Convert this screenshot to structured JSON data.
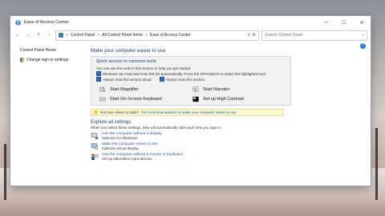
{
  "window": {
    "title": "Ease of Access Center",
    "controls": {
      "minimize": "—",
      "maximize": "☐",
      "close": "✕"
    }
  },
  "address": {
    "back": "←",
    "forward": "→",
    "up_chevron": "˅",
    "up": "↑",
    "crumbs": [
      "Control Panel",
      "All Control Panel Items",
      "Ease of Access Center"
    ],
    "separator": ">",
    "dropdown": "˅",
    "refresh": "⟳"
  },
  "search": {
    "placeholder": "Search Control Panel",
    "icon": "⌕"
  },
  "left": {
    "home": "Control Panel Home",
    "signin": "Change sign-in settings"
  },
  "main": {
    "heading": "Make your computer easier to use",
    "quick": {
      "title": "Quick access to common tools",
      "line1": "You can use the tools in this section to help you get started.",
      "line2": "Windows can read and scan this list automatically.  Press the SPACEBAR to select the highlighted tool.",
      "cb1": "Always read this section aloud",
      "cb2": "Always scan this section",
      "tools": {
        "magnifier": "Start Magnifier",
        "narrator": "Start Narrator",
        "keyboard": "Start On-Screen Keyboard",
        "contrast": "Set up High Contrast"
      }
    },
    "tip": {
      "text": "Not sure where to start?",
      "link": "Get recommendations to make your computer easier to use"
    },
    "explore": {
      "title": "Explore all settings",
      "subtitle": "When you select these settings, they will automatically start each time you sign in.",
      "options": [
        {
          "link": "Use the computer without a display",
          "desc": "Optimize for blindness"
        },
        {
          "link": "Make the computer easier to see",
          "desc": "Optimize visual display"
        },
        {
          "link": "Use the computer without a mouse or keyboard",
          "desc": "Set up alternative input devices"
        }
      ]
    },
    "help": "?"
  }
}
